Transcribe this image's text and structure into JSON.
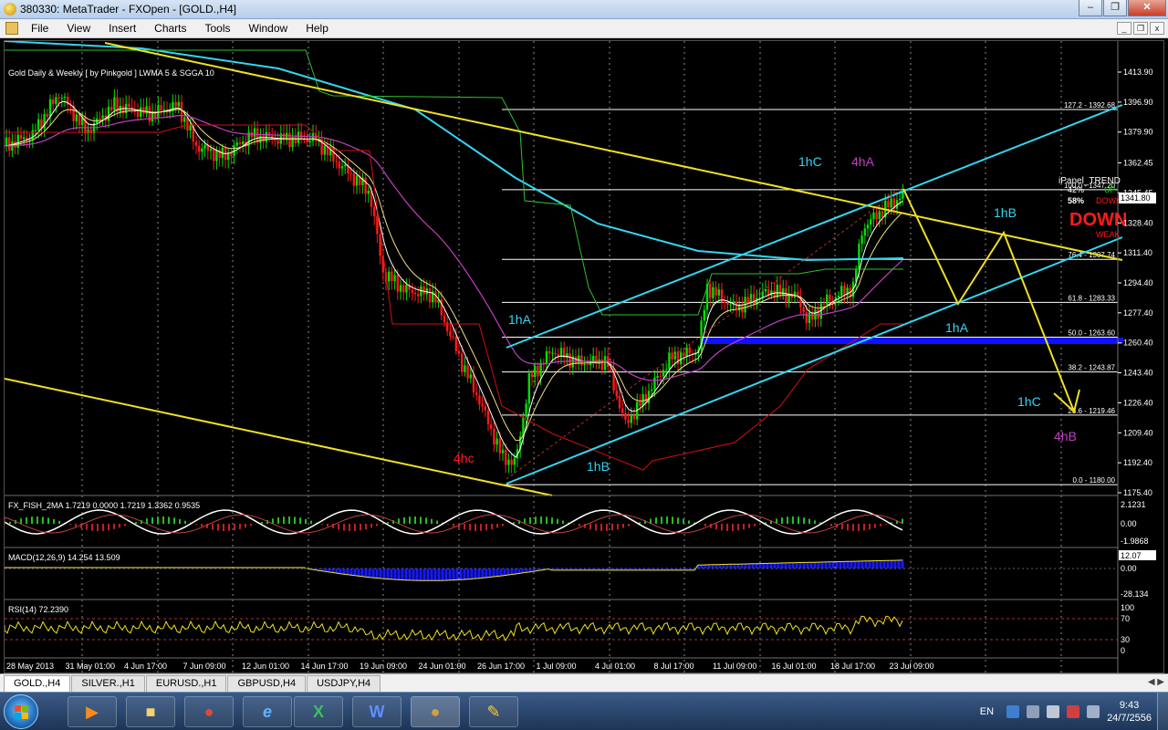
{
  "window": {
    "title": "380330: MetaTrader - FXOpen - [GOLD.,H4]"
  },
  "menu": [
    "File",
    "View",
    "Insert",
    "Charts",
    "Tools",
    "Window",
    "Help"
  ],
  "chart": {
    "header": "Gold Daily & Weekly [ by Pinkgold ] LWMA 5 & SGGA 10",
    "last_price": "1341.80",
    "price_axis": [
      "1413.90",
      "1396.90",
      "1379.90",
      "1362.45",
      "1345.45",
      "1328.40",
      "1311.40",
      "1294.40",
      "1277.40",
      "1260.40",
      "1243.40",
      "1226.40",
      "1209.40",
      "1192.40",
      "1175.40"
    ],
    "time_axis": [
      "28 May 2013",
      "31 May 01:00",
      "4 Jun 17:00",
      "7 Jun 09:00",
      "12 Jun 01:00",
      "14 Jun 17:00",
      "19 Jun 09:00",
      "24 Jun 01:00",
      "26 Jun 17:00",
      "1 Jul 09:00",
      "4 Jul 01:00",
      "8 Jul 17:00",
      "11 Jul 09:00",
      "16 Jul 01:00",
      "18 Jul 17:00",
      "23 Jul 09:00"
    ],
    "fib_levels": [
      {
        "label": "127.2 - 1392.68",
        "price": 1392.68
      },
      {
        "label": "100.0 - 1347.20",
        "price": 1347.2
      },
      {
        "label": "76.4 - 1307.74",
        "price": 1307.74
      },
      {
        "label": "61.8 - 1283.33",
        "price": 1283.33
      },
      {
        "label": "50.0 - 1263.60",
        "price": 1263.6
      },
      {
        "label": "38.2 - 1243.87",
        "price": 1243.87
      },
      {
        "label": "23.6 - 1219.46",
        "price": 1219.46
      },
      {
        "label": "0.0 - 1180.00",
        "price": 1180.0
      }
    ],
    "annotations": {
      "c1": "1hC",
      "a4": "4hA",
      "b1": "1hB",
      "a1_left": "1hA",
      "a1_right": "1hA",
      "hc4": "4hc",
      "b1_bottom": "1hB",
      "c1_right": "1hC",
      "b4": "4hB"
    },
    "ipanel": {
      "title": "iPanel_TREND",
      "pct_up": "42%",
      "up": "UP",
      "pct_down": "58%",
      "down": "DOWN",
      "big": "DOWN",
      "strength": "WEAK"
    },
    "colors": {
      "bull": "#00e000",
      "bear": "#ff1a1a",
      "cyan": "#33d6f0",
      "yellow": "#f0e020",
      "magenta": "#c040c0",
      "fib": "#ffffff",
      "zone": "#1010ff"
    }
  },
  "indicators": {
    "fish": {
      "label": "FX_FISH_2MA 1.7219 0.0000 1.7219 1.3362 0.9535",
      "axis": [
        "2.1231",
        "0.00",
        "-1.9868"
      ]
    },
    "macd": {
      "label": "MACD(12,26,9) 14.254 13.509",
      "axis": [
        "12.07",
        "0.00",
        "-28.134"
      ]
    },
    "rsi": {
      "label": "RSI(14) 72.2390",
      "axis": [
        "100",
        "70",
        "30",
        "0"
      ]
    }
  },
  "tabs": [
    "GOLD.,H4",
    "SILVER.,H1",
    "EURUSD.,H1",
    "GBPUSD,H4",
    "USDJPY,H4"
  ],
  "taskbar": {
    "lang": "EN",
    "time": "9:43",
    "date": "24/7/2556"
  }
}
